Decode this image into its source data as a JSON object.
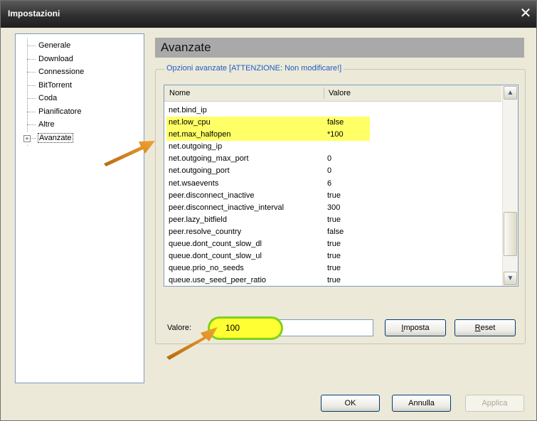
{
  "window": {
    "title": "Impostazioni",
    "close_glyph": "✕"
  },
  "tree": {
    "items": [
      {
        "label": "Generale"
      },
      {
        "label": "Download"
      },
      {
        "label": "Connessione"
      },
      {
        "label": "BitTorrent"
      },
      {
        "label": "Coda"
      },
      {
        "label": "Pianificatore"
      },
      {
        "label": "Altre"
      },
      {
        "label": "Avanzate",
        "expander": "+",
        "selected": true
      }
    ]
  },
  "panel": {
    "title": "Avanzate",
    "group_title": "Opzioni avanzate [ATTENZIONE: Non modificare!]",
    "columns": {
      "name": "Nome",
      "value": "Valore"
    },
    "rows": [
      {
        "name": "net.bind_ip",
        "value": ""
      },
      {
        "name": "net.low_cpu",
        "value": "false"
      },
      {
        "name": "net.max_halfopen",
        "value": "*100"
      },
      {
        "name": "net.outgoing_ip",
        "value": ""
      },
      {
        "name": "net.outgoing_max_port",
        "value": "0"
      },
      {
        "name": "net.outgoing_port",
        "value": "0"
      },
      {
        "name": "net.wsaevents",
        "value": "6"
      },
      {
        "name": "peer.disconnect_inactive",
        "value": "true"
      },
      {
        "name": "peer.disconnect_inactive_interval",
        "value": "300"
      },
      {
        "name": "peer.lazy_bitfield",
        "value": "true"
      },
      {
        "name": "peer.resolve_country",
        "value": "false"
      },
      {
        "name": "queue.dont_count_slow_dl",
        "value": "true"
      },
      {
        "name": "queue.dont_count_slow_ul",
        "value": "true"
      },
      {
        "name": "queue.prio_no_seeds",
        "value": "true"
      },
      {
        "name": "queue.use_seed_peer_ratio",
        "value": "true"
      }
    ],
    "value_label": "Valore:",
    "value_input": "100",
    "set_button": {
      "label_pre": "",
      "label_u": "I",
      "label_post": "mposta"
    },
    "reset_button": {
      "label_pre": "",
      "label_u": "R",
      "label_post": "eset"
    }
  },
  "footer": {
    "ok": "OK",
    "cancel": "Annulla",
    "apply": "Applica"
  },
  "colors": {
    "highlight": "#ffff66",
    "annotation_arrow": "#e08a1e",
    "ring": "#7fd11c"
  },
  "icons": {
    "scroll_up": "chevron-up-icon",
    "scroll_down": "chevron-down-icon",
    "close": "close-icon"
  }
}
